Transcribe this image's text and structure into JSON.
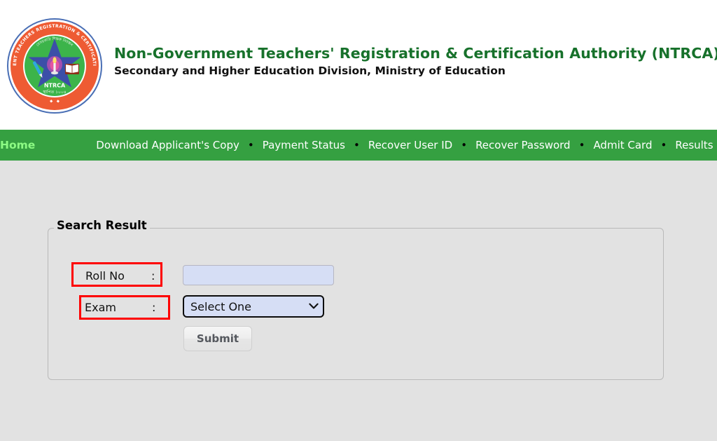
{
  "header": {
    "logo_alt": "NTRCA official seal",
    "logo_center_text": "NTRCA",
    "org_title": "Non-Government Teachers' Registration & Certification Authority (NTRCA)",
    "org_subtitle": "Secondary and Higher Education Division, Ministry of Education",
    "title_color": "#17712b"
  },
  "nav": {
    "background_color": "#35a041",
    "home_label": "Home",
    "home_color": "#8dfb84",
    "separator": "•",
    "items": [
      {
        "label": "Download Applicant's Copy"
      },
      {
        "label": "Payment Status"
      },
      {
        "label": "Recover User ID"
      },
      {
        "label": "Recover Password"
      },
      {
        "label": "Admit Card"
      },
      {
        "label": "Results"
      }
    ]
  },
  "main": {
    "fieldset_legend": "Search Result",
    "fields": {
      "roll_no": {
        "label": "Roll No",
        "colon": ":",
        "value": "",
        "placeholder": "",
        "highlight_color": "#fe0000"
      },
      "exam": {
        "label": "Exam",
        "colon": ":",
        "selected": "Select One",
        "options": [
          "Select One"
        ],
        "highlight_color": "#fe0000"
      }
    },
    "submit_label": "Submit"
  }
}
